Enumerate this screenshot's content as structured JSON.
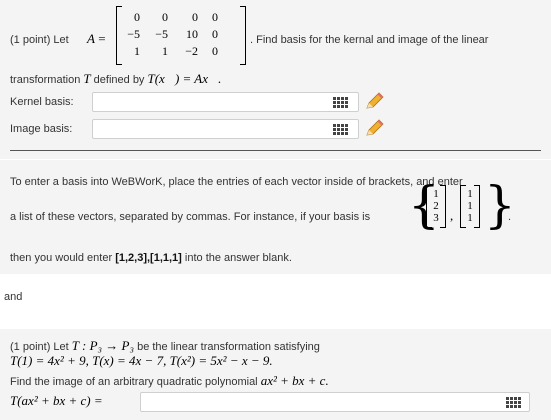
{
  "problem1": {
    "prefix": "(1 point) Let",
    "matrix_name": "A",
    "equals": "=",
    "matrix": [
      [
        "0",
        "0",
        "0",
        "0"
      ],
      [
        "−5",
        "−5",
        "10",
        "0"
      ],
      [
        "1",
        "1",
        "−2",
        "0"
      ]
    ],
    "after_matrix": ". Find basis for the kernal and image of the linear",
    "line2_a": "transformation",
    "line2_T": "T",
    "line2_b": "defined by",
    "line2_formula": "T(x⃗) = Ax⃗.",
    "kernel_label": "Kernel basis:",
    "kernel_value": "",
    "image_label": "Image basis:",
    "image_value": ""
  },
  "hint": {
    "line1": "To enter a basis into WeBWorK, place the entries of each vector inside of brackets, and enter",
    "line2": "a list of these vectors, separated by commas. For instance, if your basis is",
    "vector1": [
      "1",
      "2",
      "3"
    ],
    "vector2": [
      "1",
      "1",
      "1"
    ],
    "comma": ",",
    "period": ".",
    "line3_a": "then you would enter",
    "line3_bold": "[1,2,3],[1,1,1]",
    "line3_b": "into the answer blank."
  },
  "separator_text": "and",
  "problem2": {
    "line1_prefix": "(1 point) Let",
    "line1_math": "T : P₃ → P₃",
    "line1_suffix": "be the linear transformation satisfying",
    "line2_math": "T(1) = 4x² + 9, T(x) = 4x − 7, T(x²) = 5x² − x − 9.",
    "line3_a": "Find the image of an arbitrary quadratic polynomial",
    "line3_math": "ax² + bx + c.",
    "answer_label": "T(ax² + bx + c) =",
    "answer_value": ""
  },
  "icons": {
    "grid": "matrix-entry-icon",
    "pencil": "pencil-edit-icon"
  }
}
